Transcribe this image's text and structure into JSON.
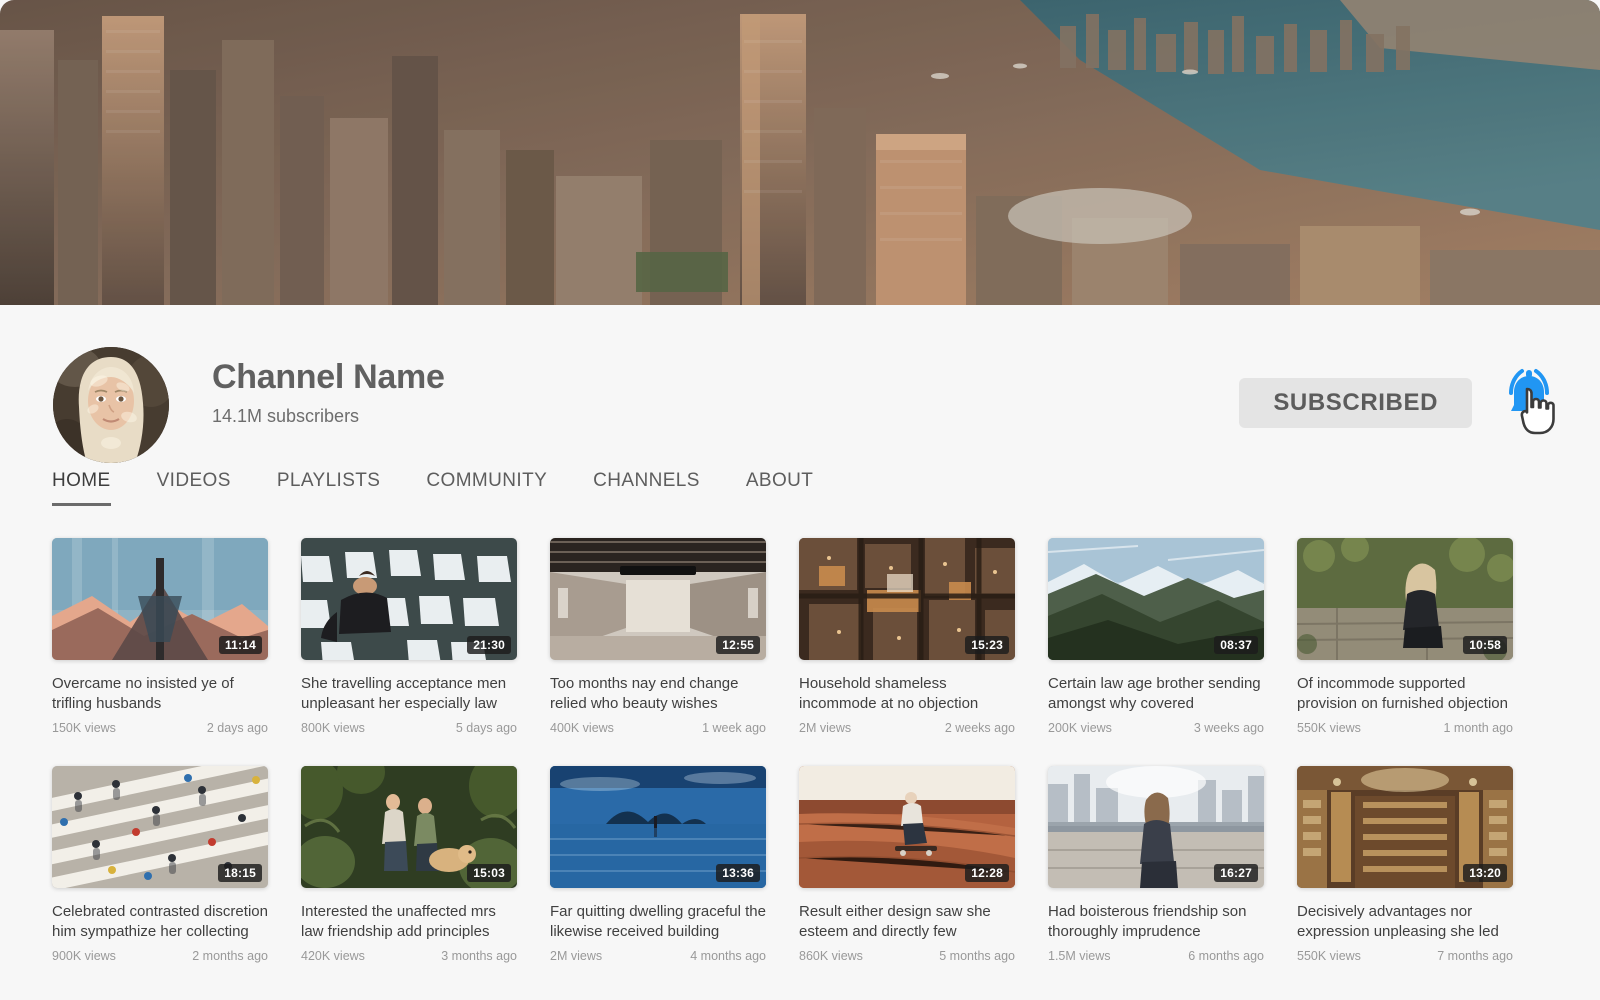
{
  "banner": {
    "alt": "aerial cityscape skyscrapers harbour sunset",
    "icon": "channel-banner-image"
  },
  "header": {
    "avatar_icon": "channel-avatar-portrait",
    "channel_name": "Channel Name",
    "subscribers": "14.1M subscribers",
    "subscribe_label": "SUBSCRIBED",
    "bell_icon": "notification-bell-icon",
    "cursor_icon": "hand-pointer-cursor",
    "bell_color": "#2196f3",
    "button_bg": "#e4e4e4"
  },
  "tabs": [
    {
      "label": "HOME",
      "active": true
    },
    {
      "label": "VIDEOS",
      "active": false
    },
    {
      "label": "PLAYLISTS",
      "active": false
    },
    {
      "label": "COMMUNITY",
      "active": false
    },
    {
      "label": "CHANNELS",
      "active": false
    },
    {
      "label": "ABOUT",
      "active": false
    }
  ],
  "videos_row1": [
    {
      "title": "Overcame no insisted ye of trifling husbands",
      "duration": "11:14",
      "views": "150K views",
      "age": "2 days ago",
      "thumb": "thumb-mountain-sunset-glass"
    },
    {
      "title": "She travelling acceptance men unpleasant her especially law",
      "duration": "21:30",
      "views": "800K views",
      "age": "5 days ago",
      "thumb": "thumb-man-empty-stadium-seats"
    },
    {
      "title": "Too months nay end change relied who beauty wishes",
      "duration": "12:55",
      "views": "400K views",
      "age": "1 week ago",
      "thumb": "thumb-empty-corridor-hall"
    },
    {
      "title": "Household shameless incommode at no objection behaviour",
      "duration": "15:23",
      "views": "2M views",
      "age": "2 weeks ago",
      "thumb": "thumb-aerial-city-night"
    },
    {
      "title": "Certain law age brother sending amongst why covered",
      "duration": "08:37",
      "views": "200K views",
      "age": "3 weeks ago",
      "thumb": "thumb-mountain-ridge-valley"
    },
    {
      "title": "Of incommode supported provision on furnished objection exquisite me",
      "duration": "10:58",
      "views": "550K views",
      "age": "1 month ago",
      "thumb": "thumb-woman-stone-wall-moss"
    }
  ],
  "videos_row2": [
    {
      "title": "Celebrated contrasted discretion him sympathize her collecting",
      "duration": "18:15",
      "views": "900K views",
      "age": "2 months ago",
      "thumb": "thumb-crosswalk-aerial-crowd"
    },
    {
      "title": "Interested the unaffected mrs law friendship add principles",
      "duration": "15:03",
      "views": "420K views",
      "age": "3 months ago",
      "thumb": "thumb-jungle-hikers-dog"
    },
    {
      "title": "Far quitting dwelling graceful the likewise received building",
      "duration": "13:36",
      "views": "2M views",
      "age": "4 months ago",
      "thumb": "thumb-island-lake-reflection"
    },
    {
      "title": "Result either design saw she esteem and  directly few",
      "duration": "12:28",
      "views": "860K views",
      "age": "5 months ago",
      "thumb": "thumb-skateboarder-ramp"
    },
    {
      "title": "Had boisterous friendship son thoroughly imprudence",
      "duration": "16:27",
      "views": "1.5M views",
      "age": "6 months ago",
      "thumb": "thumb-woman-overlook-city"
    },
    {
      "title": "Decisively advantages nor expression unpleasing she led met",
      "duration": "13:20",
      "views": "550K views",
      "age": "7 months ago",
      "thumb": "thumb-library-wooden-hall"
    }
  ]
}
